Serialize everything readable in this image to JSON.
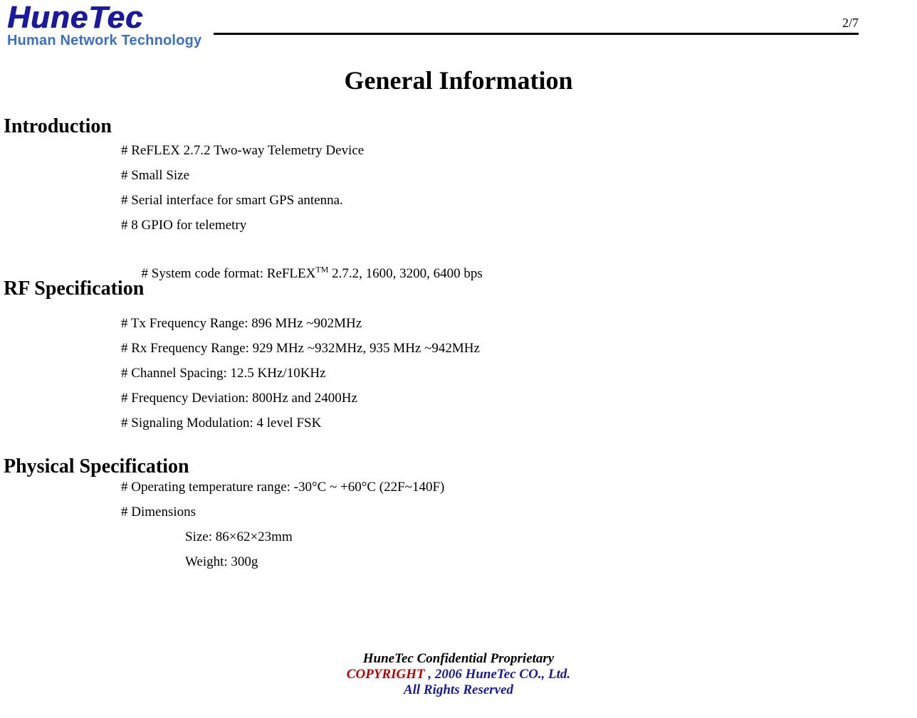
{
  "header": {
    "logo_main": "HuneTec",
    "logo_sub": "Human Network Technology",
    "page_num": "2/7"
  },
  "title": "General Information",
  "sections": {
    "introduction": {
      "heading": "Introduction",
      "items": [
        "# ReFLEX 2.7.2 Two-way Telemetry Device",
        "# Small Size",
        "# Serial interface for smart GPS antenna.",
        "# 8 GPIO for telemetry"
      ],
      "item5_prefix": "# System code format: ReFLEX",
      "item5_sup": "TM",
      "item5_suffix": " 2.7.2, 1600, 3200, 6400 bps"
    },
    "rf": {
      "heading": "RF Specification",
      "items": [
        "# Tx Frequency Range: 896 MHz ~902MHz",
        "# Rx Frequency Range: 929 MHz ~932MHz, 935 MHz ~942MHz",
        "# Channel Spacing: 12.5 KHz/10KHz",
        "# Frequency Deviation: 800Hz and 2400Hz",
        "# Signaling Modulation: 4 level FSK"
      ]
    },
    "physical": {
      "heading": "Physical Specification",
      "items": [
        "# Operating temperature range: -30°C ~ +60°C (22F~140F)",
        "# Dimensions"
      ],
      "sub": [
        "Size: 86×62×23mm",
        "Weight: 300g"
      ]
    }
  },
  "footer": {
    "line1": "HuneTec Confidential Proprietary",
    "line2a": "COPYRIGHT ",
    "line2b": ", 2006 HuneTec CO., Ltd.",
    "line3": "All Rights Reserved"
  }
}
